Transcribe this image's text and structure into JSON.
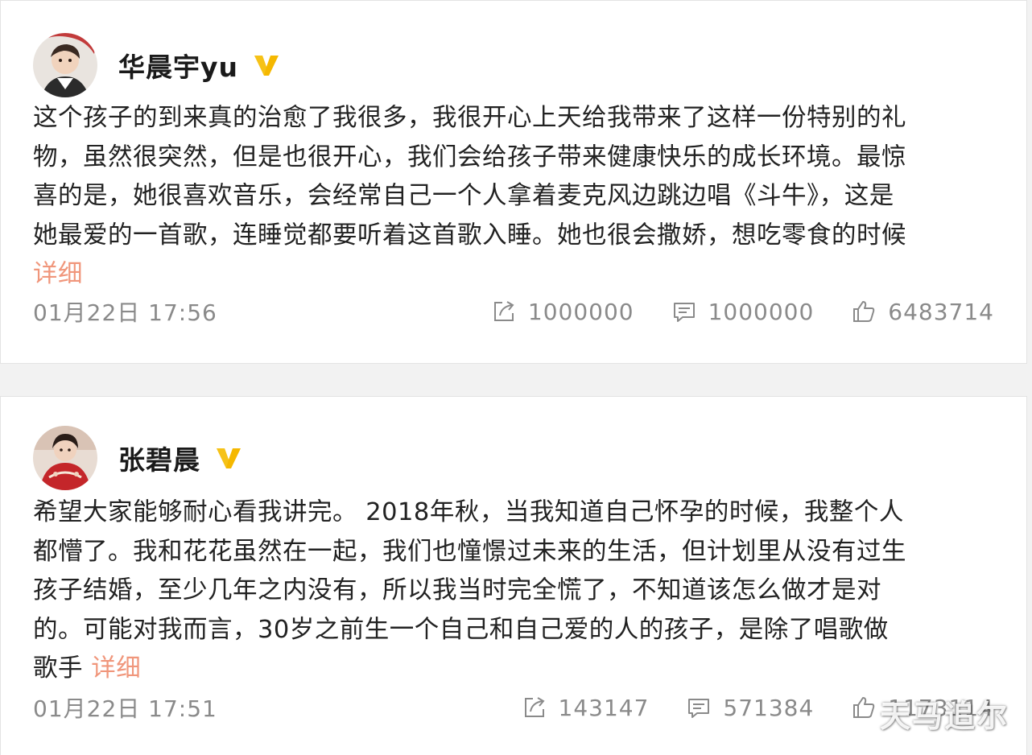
{
  "colors": {
    "background": "#f2f2f2",
    "card": "#ffffff",
    "text": "#222222",
    "muted": "#8a8a8a",
    "more_link": "#eb7350",
    "verified_badge": "#f5b800"
  },
  "posts": [
    {
      "author": "华晨宇yu",
      "verified_icon": "verified-badge-icon",
      "content_lines": [
        "这个孩子的到来真的治愈了我很多，我很开心上天给我带来了这样一份特别的礼",
        "物，虽然很突然，但是也很开心，我们会给孩子带来健康快乐的成长环境。最惊",
        "喜的是，她很喜欢音乐，会经常自己一个人拿着麦克风边跳边唱《斗牛》，这是",
        "她最爱的一首歌，连睡觉都要听着这首歌入睡。她也很会撒娇，想吃零食的时候"
      ],
      "last_line_prefix": "",
      "more_label": "详细",
      "time": "01月22日 17:56",
      "repost_count": "1000000",
      "comment_count": "1000000",
      "like_count": "6483714"
    },
    {
      "author": "张碧晨",
      "verified_icon": "verified-badge-icon",
      "content_lines": [
        "希望大家能够耐心看我讲完。 2018年秋，当我知道自己怀孕的时候，我整个人",
        "都懵了。我和花花虽然在一起，我们也憧憬过未来的生活，但计划里从没有过生",
        "孩子结婚，至少几年之内没有，所以我当时完全慌了，不知道该怎么做才是对",
        "的。可能对我而言，30岁之前生一个自己和自己爱的人的孩子，是除了唱歌做"
      ],
      "last_line_prefix": "歌手 ",
      "more_label": "详细",
      "time": "01月22日 17:51",
      "repost_count": "143147",
      "comment_count": "571384",
      "like_count": "1173114"
    }
  ],
  "watermark": "天马追尔"
}
